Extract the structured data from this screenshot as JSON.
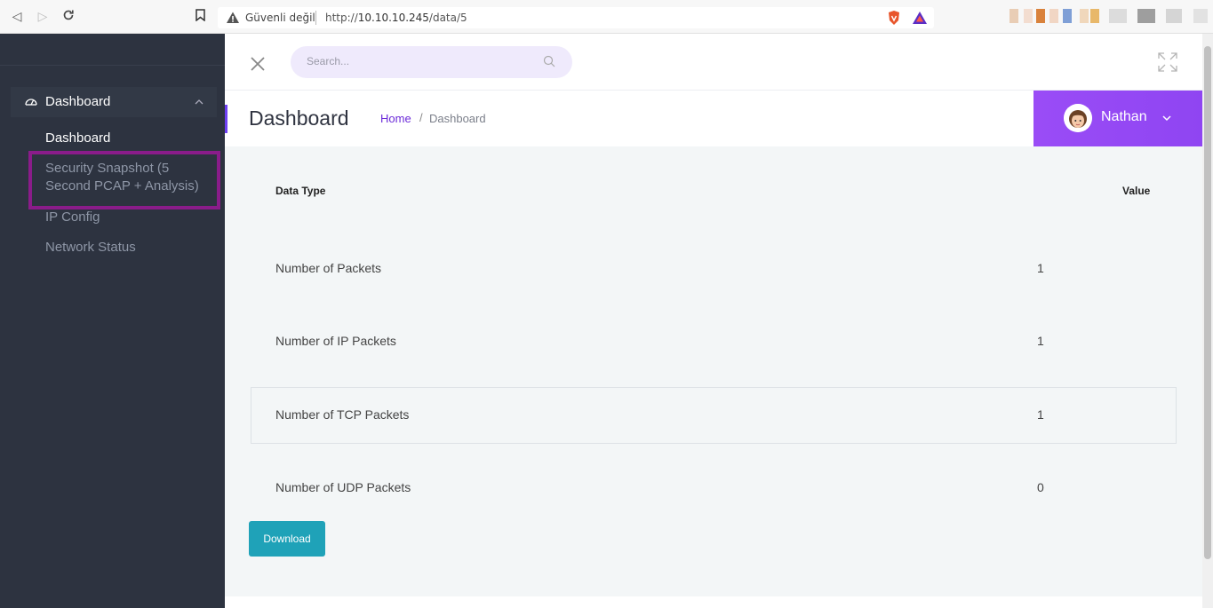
{
  "browser": {
    "insecure_label": "Güvenli değil",
    "url_prefix": "http://",
    "url_host": "10.10.10.245",
    "url_path": "/data/5"
  },
  "sidebar": {
    "group_label": "Dashboard",
    "items": [
      {
        "label": "Dashboard"
      },
      {
        "label": "Security Snapshot (5"
      },
      {
        "label": "Second PCAP + Analysis)"
      },
      {
        "label": "IP Config"
      },
      {
        "label": "Network Status"
      }
    ]
  },
  "header": {
    "search_placeholder": "Search..."
  },
  "title": {
    "page_title": "Dashboard",
    "breadcrumb_home": "Home",
    "breadcrumb_sep": "/",
    "breadcrumb_current": "Dashboard"
  },
  "user": {
    "name": "Nathan"
  },
  "table": {
    "headers": [
      "Data Type",
      "Value"
    ],
    "rows": [
      {
        "label": "Number of Packets",
        "value": "1"
      },
      {
        "label": "Number of IP Packets",
        "value": "1"
      },
      {
        "label": "Number of TCP Packets",
        "value": "1"
      },
      {
        "label": "Number of UDP Packets",
        "value": "0"
      }
    ]
  },
  "actions": {
    "download_label": "Download"
  },
  "colors": {
    "sidebar_bg": "#2d3340",
    "accent_purple": "#9a4cf6",
    "download_teal": "#1fa2b8",
    "highlight_border": "#8a1c8a"
  }
}
